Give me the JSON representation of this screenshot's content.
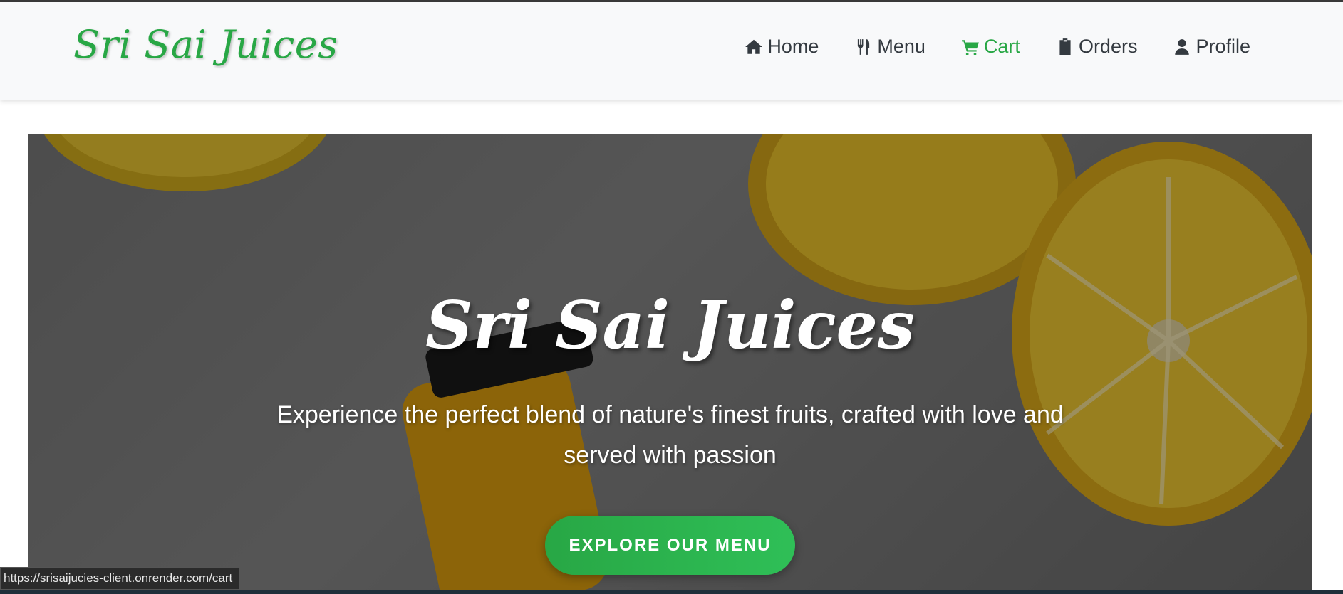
{
  "brand": "Sri Sai Juices",
  "nav": [
    {
      "label": "Home",
      "icon": "home-icon"
    },
    {
      "label": "Menu",
      "icon": "utensils-icon"
    },
    {
      "label": "Cart",
      "icon": "cart-icon",
      "active": true
    },
    {
      "label": "Orders",
      "icon": "clipboard-icon"
    },
    {
      "label": "Profile",
      "icon": "user-icon"
    }
  ],
  "hero": {
    "title": "Sri Sai Juices",
    "subtitle": "Experience the perfect blend of nature's finest fruits, crafted with love and served with passion",
    "button": "EXPLORE OUR MENU"
  },
  "status_url": "https://srisaijucies-client.onrender.com/cart",
  "colors": {
    "accent": "#28a745",
    "nav_text": "#343a40",
    "navbar_bg": "#f8f9fa"
  }
}
